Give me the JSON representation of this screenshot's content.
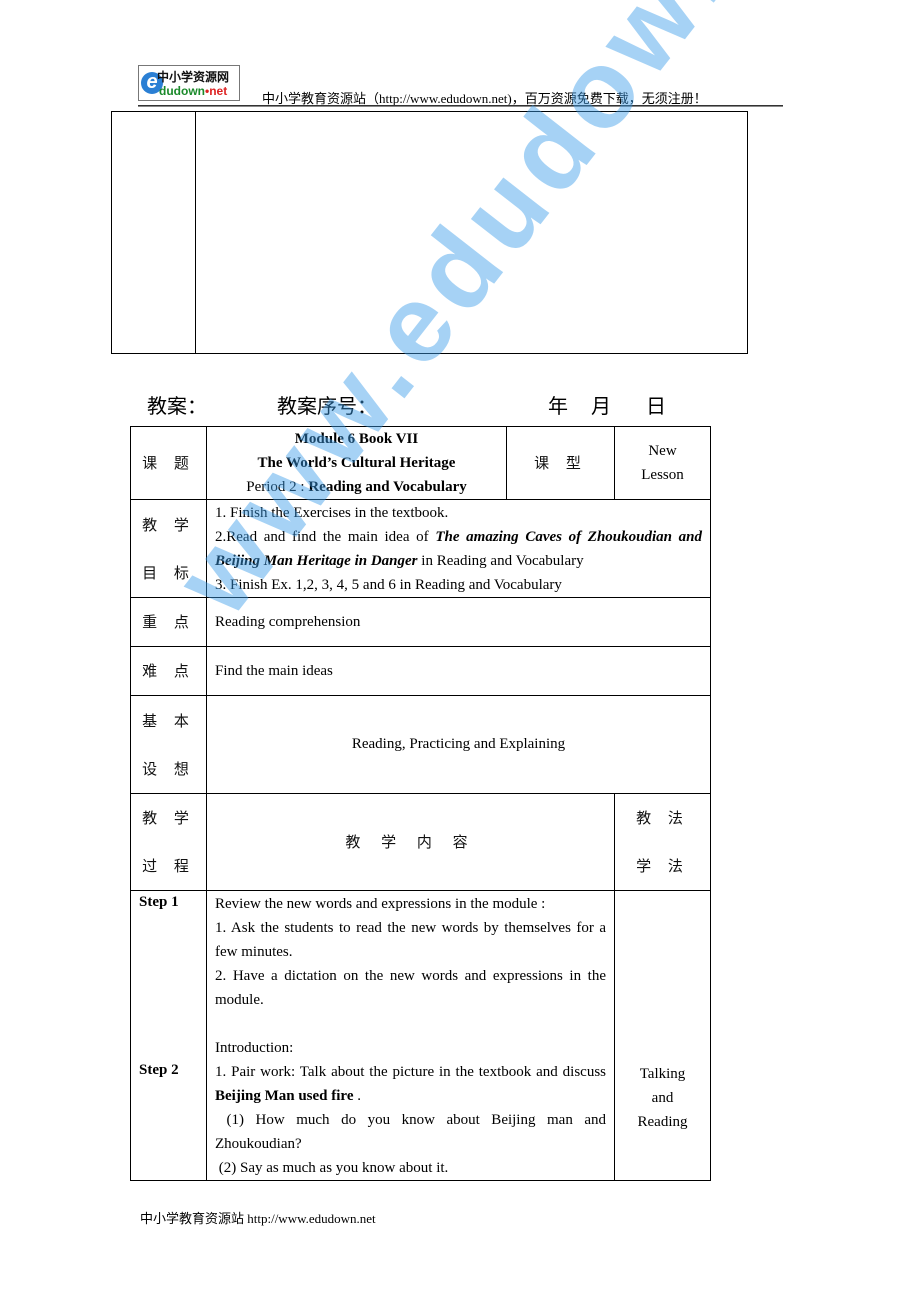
{
  "header": {
    "logo": {
      "cn": "中小学资源网",
      "en_prefix": "dudown",
      "en_dot": "•",
      "en_suffix": "net",
      "icon": "ie-e-icon"
    },
    "text": "中小学教育资源站（http://www.edudown.net)，百万资源免费下载，无须注册！"
  },
  "meta": {
    "lesson_plan_label": "教案：",
    "lesson_number_label": "教案序号：",
    "year_label": "年",
    "month_label": "月",
    "day_label": "日"
  },
  "plan": {
    "topic": {
      "label": "课 题",
      "line1": "Module 6 Book VII",
      "line2": "The World’s Cultural Heritage",
      "line3_prefix": "Period 2 : ",
      "line3_bold": "Reading and Vocabulary",
      "type_label": "课 型",
      "type_value_1": "New",
      "type_value_2": "Lesson"
    },
    "objectives": {
      "label_1": "教 学",
      "label_2": "目 标",
      "item1": "1. Finish the Exercises in the textbook.",
      "item2_prefix": "2.Read and find the main idea of ",
      "item2_title1": "The amazing Caves of Zhoukoudian and Beijing Man Heritage in Danger",
      "item2_suffix": " in Reading and Vocabulary",
      "item3": "3. Finish Ex. 1,2, 3, 4, 5 and 6 in Reading and Vocabulary"
    },
    "key_points": {
      "label": "重 点",
      "value": "Reading comprehension"
    },
    "difficulties": {
      "label": "难 点",
      "value": "Find the main ideas"
    },
    "basic_idea": {
      "label_1": "基 本",
      "label_2": "设 想",
      "value": "Reading, Practicing and Explaining"
    },
    "process_header": {
      "label_1": "教 学",
      "label_2": "过 程",
      "content_label": "教 学 内 容",
      "method_label_1": "教 法",
      "method_label_2": "学 法"
    },
    "steps": [
      {
        "label": "Step 1",
        "lines": [
          "Review the new words and expressions in the module :",
          "1. Ask the students to read the new words by themselves for a few minutes.",
          "2. Have a dictation on the new words and expressions in the module."
        ]
      },
      {
        "label": "Step 2",
        "intro": "Introduction:",
        "item1_prefix": "1. Pair work: Talk about the picture in the textbook and discuss ",
        "item1_bold": "Beijing Man used fire",
        "item1_suffix": " .",
        "q1": " (1) How much do you know about Beijing man and Zhoukoudian?",
        "q2": " (2) Say as much as you know about it.",
        "method_1": "Talking",
        "method_2": "and",
        "method_3": "Reading"
      }
    ]
  },
  "footer": {
    "text": "中小学教育资源站  http://www.edudown.net"
  },
  "watermark": {
    "text": "www.edudown.net"
  }
}
